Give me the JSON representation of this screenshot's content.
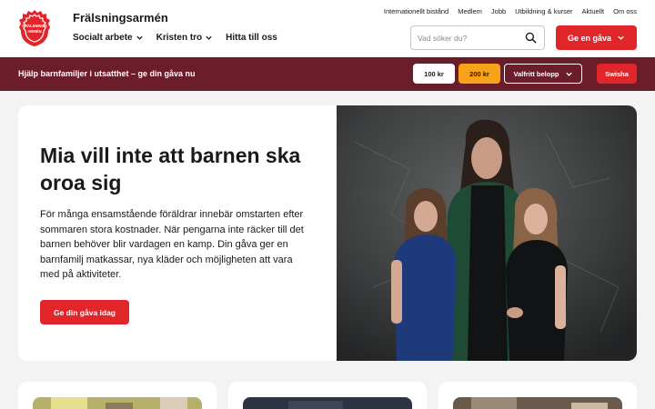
{
  "header": {
    "site_name": "Frälsningsarmén",
    "logo_text": "FRÄLSNINGSARMÉN",
    "nav": [
      {
        "label": "Socialt arbete",
        "has_dropdown": true
      },
      {
        "label": "Kristen tro",
        "has_dropdown": true
      },
      {
        "label": "Hitta till oss",
        "has_dropdown": false
      }
    ],
    "utility_links": [
      "Internationellt bistånd",
      "Medlem",
      "Jobb",
      "Utbildning & kurser",
      "Aktuellt",
      "Om oss"
    ],
    "search": {
      "placeholder": "Vad söker du?",
      "value": ""
    },
    "give_button": "Ge en gåva",
    "accent_color": "#e0262b"
  },
  "donate_bar": {
    "text": "Hjälp barnfamiljer i utsatthet – ge din gåva nu",
    "amounts": [
      "100 kr",
      "200 kr"
    ],
    "selected_amount": "200 kr",
    "custom_amount": "Valfritt belopp",
    "swish_button": "Swisha",
    "background_color": "#6b1d2a"
  },
  "hero": {
    "title": "Mia vill inte att barnen ska oroa sig",
    "body": "För många ensamstående föräldrar innebär omstarten efter sommaren stora kostnader. När pengarna inte räcker till det barnen behöver blir vardagen en kamp. Din gåva ger en barnfamilj matkassar, nya kläder och möjligheten att vara med på aktiviteter.",
    "cta": "Ge din gåva idag"
  }
}
